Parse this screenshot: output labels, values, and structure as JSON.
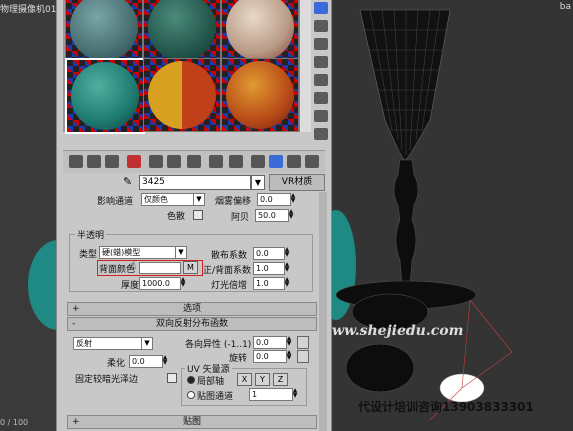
{
  "viewport_left": {
    "label": "物理摄像机01 [",
    "status": "0 / 100"
  },
  "viewport_right": {
    "label": "ba",
    "watermark": "www.shejiedu.com",
    "ad_text": "代设计培训咨询13903833301"
  },
  "material": {
    "name": "3425",
    "dropdown_arrow": "▼",
    "type_button": "VR材质"
  },
  "reflection_section": {
    "affect_channel_label": "影响通道",
    "affect_channel_value": "仅颜色",
    "fog_bias_label": "烟雾偏移",
    "fog_bias_value": "0.0",
    "color_label": "色散",
    "abbe_label": "阿贝",
    "abbe_value": "50.0"
  },
  "translucency": {
    "group_title": "半透明",
    "type_label": "类型",
    "type_value": "硬(蜡)模型",
    "scatter_label": "散布系数",
    "scatter_value": "0.0",
    "back_color_label": "背面颜色",
    "back_color_button": "M",
    "front_back_label": "正/背面系数",
    "front_back_value": "1.0",
    "thickness_label": "厚度",
    "thickness_value": "1000.0",
    "light_mult_label": "灯光倍增",
    "light_mult_value": "1.0"
  },
  "options_rollout": {
    "sign": "+",
    "title": "选项"
  },
  "brdf_rollout": {
    "sign": "-",
    "title": "双向反射分布函数",
    "type_value": "反射",
    "anisotropy_label": "各向异性 (-1..1)",
    "anisotropy_value": "0.0",
    "rotation_label": "旋转",
    "rotation_value": "0.0",
    "soften_label": "柔化",
    "soften_value": "0.0",
    "fix_dark_label": "固定较暗光泽边",
    "uv_label": "UV 矢量源",
    "local_axis_label": "局部轴",
    "axis_x": "X",
    "axis_y": "Y",
    "axis_z": "Z",
    "map_channel_label": "贴图通道",
    "map_channel_value": "1"
  },
  "maps_rollout": {
    "sign": "+",
    "title": "贴图"
  }
}
